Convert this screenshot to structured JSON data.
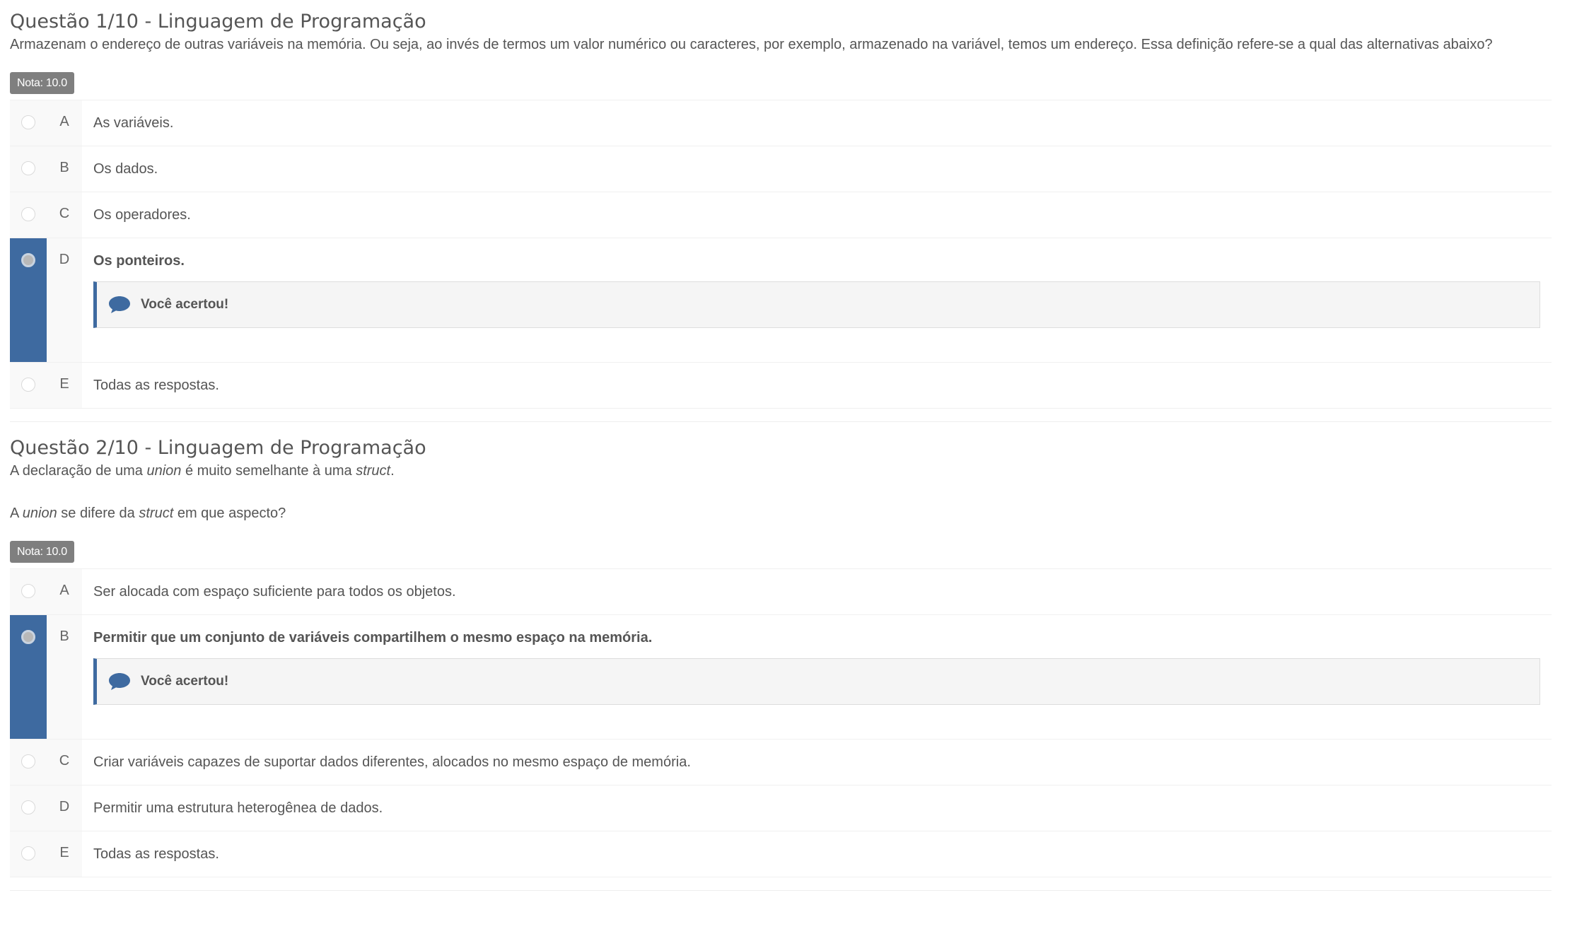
{
  "questions": [
    {
      "title": "Questão 1/10 - Linguagem de Programação",
      "text": "Armazenam o endereço de outras variáveis na memória. Ou seja, ao invés de termos um valor numérico ou caracteres, por exemplo, armazenado na variável, temos um endereço. Essa definição refere-se a qual das alternativas abaixo?",
      "nota": "Nota: 10.0",
      "options": [
        {
          "letter": "A",
          "text": "As variáveis."
        },
        {
          "letter": "B",
          "text": "Os dados."
        },
        {
          "letter": "C",
          "text": "Os operadores."
        },
        {
          "letter": "D",
          "text": "Os ponteiros.",
          "feedback": "Você acertou!"
        },
        {
          "letter": "E",
          "text": "Todas as respostas."
        }
      ]
    },
    {
      "title": "Questão 2/10 - Linguagem de Programação",
      "text_line1": {
        "a": "A declaração de uma ",
        "b": "union",
        "c": " é muito semelhante à uma ",
        "d": "struct",
        "e": "."
      },
      "text_line2": {
        "a": "A ",
        "b": "union",
        "c": " se difere da ",
        "d": "struct",
        "e": " em que aspecto?"
      },
      "nota": "Nota: 10.0",
      "options": [
        {
          "letter": "A",
          "text": "Ser alocada com espaço suficiente para todos os objetos."
        },
        {
          "letter": "B",
          "text": "Permitir que um conjunto de variáveis compartilhem o mesmo espaço na memória.",
          "feedback": "Você acertou!"
        },
        {
          "letter": "C",
          "text": "Criar variáveis capazes de suportar dados diferentes, alocados no mesmo espaço de memória."
        },
        {
          "letter": "D",
          "text": "Permitir uma estrutura heterogênea de dados."
        },
        {
          "letter": "E",
          "text": "Todas as respostas."
        }
      ]
    }
  ],
  "colors": {
    "accent": "#3e6aa0",
    "nota_bg": "#7f7f7f",
    "text": "#555555"
  },
  "icons": {
    "feedback": "speech-bubble-icon",
    "option": "radio-icon"
  }
}
